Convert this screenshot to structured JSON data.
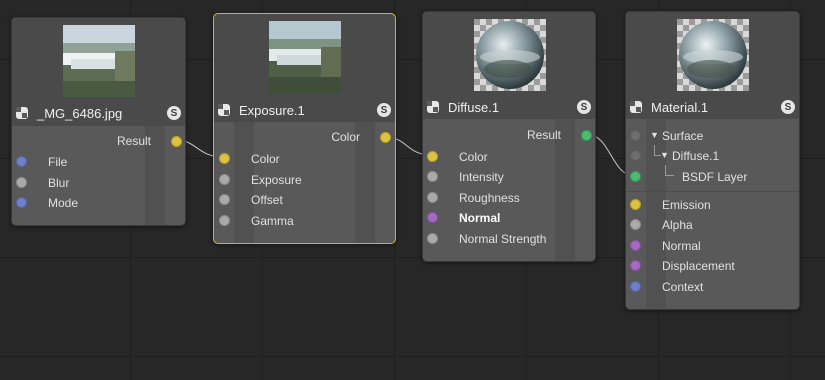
{
  "nodes": {
    "image": {
      "title": "_MG_6486.jpg",
      "output": "Result",
      "inputs": [
        "File",
        "Blur",
        "Mode"
      ]
    },
    "exposure": {
      "title": "Exposure.1",
      "output": "Color",
      "inputs": [
        "Color",
        "Exposure",
        "Offset",
        "Gamma"
      ]
    },
    "diffuse": {
      "title": "Diffuse.1",
      "output": "Result",
      "inputs": [
        "Color",
        "Intensity",
        "Roughness",
        "Normal",
        "Normal Strength"
      ]
    },
    "material": {
      "title": "Material.1",
      "tree": [
        "Surface",
        "Diffuse.1",
        "BSDF Layer"
      ],
      "inputs": [
        "Emission",
        "Alpha",
        "Normal",
        "Displacement",
        "Context"
      ]
    }
  },
  "badge": "S",
  "colors": {
    "selected_border": "#e3a92e",
    "port_color": "#dcc23f",
    "port_float": "#aaaaaa",
    "port_int": "#7080c8",
    "port_vector": "#a569c2",
    "port_bsdf": "#4dbb6d"
  }
}
